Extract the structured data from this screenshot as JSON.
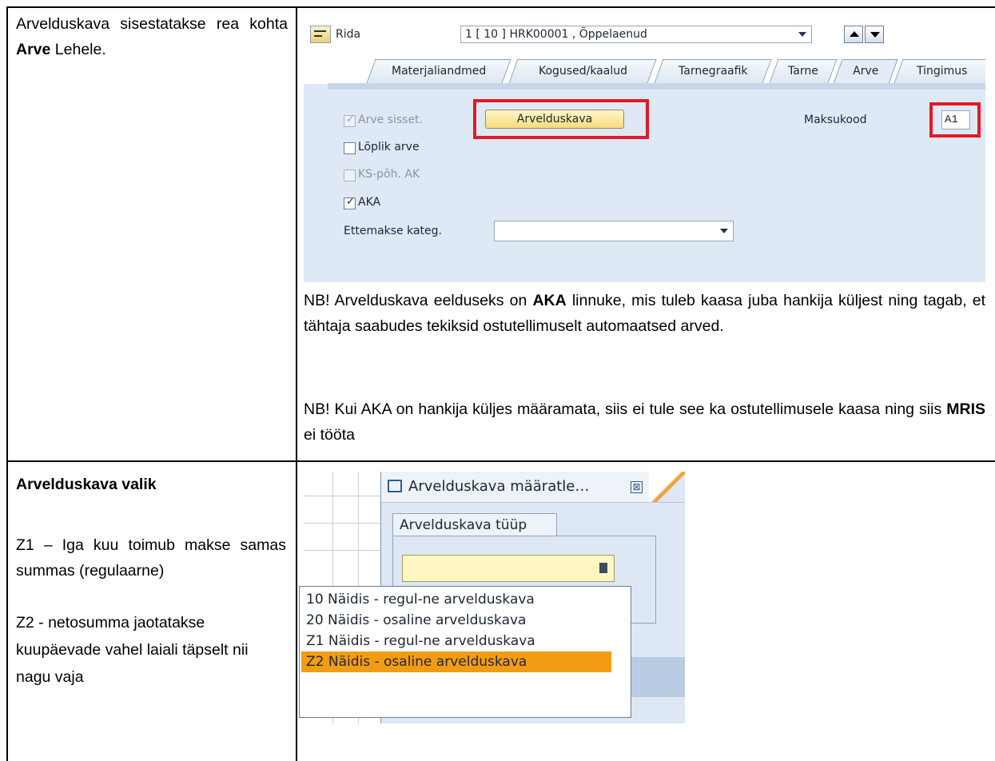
{
  "row1": {
    "left_text_part1": "Arvelduskava sisestatakse rea kohta ",
    "left_text_bold": "Arve",
    "left_text_part2": " Lehele.",
    "sap": {
      "rida_label": "Rida",
      "row_combo": "1 [ 10 ] HRK00001 , Õppelaenud",
      "tabs": [
        "Materjaliandmed",
        "Kogused/kaalud",
        "Tarnegraafik",
        "Tarne",
        "Arve",
        "Tingimus"
      ],
      "active_tab": "Arve",
      "checkboxes": [
        {
          "label": "Arve sisset.",
          "checked": true,
          "disabled": true
        },
        {
          "label": "Lõplik arve",
          "checked": false,
          "disabled": false
        },
        {
          "label": "KS-põh. AK",
          "checked": false,
          "disabled": true
        },
        {
          "label": "AKA",
          "checked": true,
          "disabled": false
        }
      ],
      "tick": "✓",
      "button_label": "Arvelduskava",
      "maksukood_label": "Maksukood",
      "maksukood_value": "A1",
      "ettemakse_label": "Ettemakse kateg.",
      "ettemakse_value": "",
      "highlight_color": "#e01b24"
    },
    "note1_pre": "NB! Arvelduskava eelduseks on ",
    "note1_bold": "AKA",
    "note1_post": " linnuke, mis tuleb kaasa juba hankija küljest ning tagab, et tähtaja saabudes tekiksid ostutellimuselt automaatsed arved.",
    "note2_pre": "NB! Kui AKA on hankija küljes määramata, siis ei tule see ka ostutellimusele kaasa ning siis ",
    "note2_bold": "MRIS",
    "note2_post": " ei tööta"
  },
  "row2": {
    "heading": "Arvelduskava valik",
    "z1_text": "Z1 – Iga kuu toimub makse samas summas (regulaarne)",
    "z2_text": "Z2 - netosumma jaotatakse kuupäevade vahel laiali täpselt nii nagu vaja",
    "sap": {
      "dialog_title": "Arvelduskava määratle…",
      "close_symbol": "⊠",
      "group_title": "Arvelduskava tüüp",
      "options": [
        "10 Näidis - regul-ne arvelduskava",
        "20 Näidis - osaline arvelduskava",
        "Z1 Näidis - regul-ne arvelduskava",
        "Z2 Näidis - osaline arvelduskava"
      ],
      "selected_option": "Z2 Näidis - osaline arvelduskava",
      "selected_color": "#f39c12"
    }
  }
}
